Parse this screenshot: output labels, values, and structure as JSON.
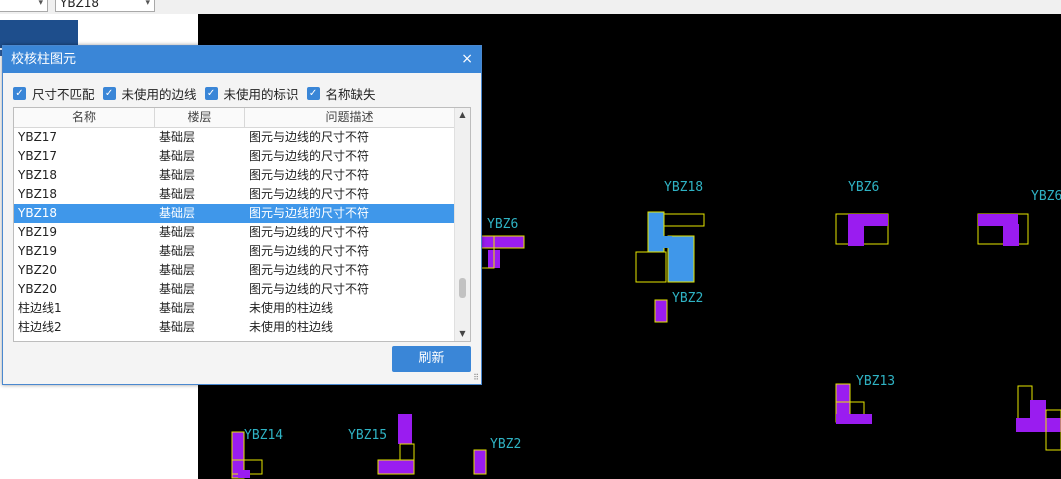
{
  "toolbar": {
    "combo_left_value": "",
    "combo_right_value": "YBZ18"
  },
  "dialog": {
    "title": "校核柱图元",
    "close_symbol": "×",
    "filters": [
      {
        "label": "尺寸不匹配",
        "checked": true
      },
      {
        "label": "未使用的边线",
        "checked": true
      },
      {
        "label": "未使用的标识",
        "checked": true
      },
      {
        "label": "名称缺失",
        "checked": true
      }
    ],
    "columns": [
      "名称",
      "楼层",
      "问题描述"
    ],
    "rows": [
      {
        "name": "YBZ17",
        "floor": "基础层",
        "desc": "图元与边线的尺寸不符",
        "selected": false
      },
      {
        "name": "YBZ17",
        "floor": "基础层",
        "desc": "图元与边线的尺寸不符",
        "selected": false
      },
      {
        "name": "YBZ18",
        "floor": "基础层",
        "desc": "图元与边线的尺寸不符",
        "selected": false
      },
      {
        "name": "YBZ18",
        "floor": "基础层",
        "desc": "图元与边线的尺寸不符",
        "selected": false
      },
      {
        "name": "YBZ18",
        "floor": "基础层",
        "desc": "图元与边线的尺寸不符",
        "selected": true
      },
      {
        "name": "YBZ19",
        "floor": "基础层",
        "desc": "图元与边线的尺寸不符",
        "selected": false
      },
      {
        "name": "YBZ19",
        "floor": "基础层",
        "desc": "图元与边线的尺寸不符",
        "selected": false
      },
      {
        "name": "YBZ20",
        "floor": "基础层",
        "desc": "图元与边线的尺寸不符",
        "selected": false
      },
      {
        "name": "YBZ20",
        "floor": "基础层",
        "desc": "图元与边线的尺寸不符",
        "selected": false
      },
      {
        "name": "柱边线1",
        "floor": "基础层",
        "desc": "未使用的柱边线",
        "selected": false
      },
      {
        "name": "柱边线2",
        "floor": "基础层",
        "desc": "未使用的柱边线",
        "selected": false
      }
    ],
    "refresh_label": "刷新"
  },
  "canvas_labels": [
    "YBZ18",
    "YBZ6",
    "YBZ6",
    "YBZ6",
    "YBZ2",
    "YBZ13",
    "YBZ14",
    "YBZ15",
    "YBZ2"
  ],
  "colors": {
    "title_bar": "#3a86d7",
    "selection": "#3f97ea",
    "cad_background": "#000000",
    "column_fill": "#9a1cf0",
    "outline": "#e6e600",
    "label": "#2fb3c4"
  }
}
